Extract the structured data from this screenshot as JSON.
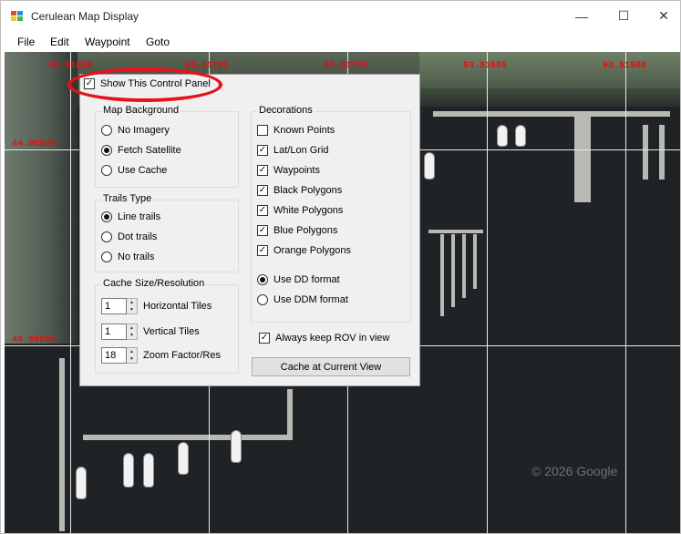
{
  "window": {
    "title": "Cerulean Map Display",
    "minimize_icon": "minimize-icon",
    "maximize_icon": "maximize-icon",
    "close_icon": "close-icon",
    "min_glyph": "—",
    "max_glyph": "☐",
    "close_glyph": "✕"
  },
  "menu": {
    "items": [
      {
        "label": "File"
      },
      {
        "label": "Edit"
      },
      {
        "label": "Waypoint"
      },
      {
        "label": "Goto"
      }
    ]
  },
  "map": {
    "grid_labels_top": [
      "93.51858",
      "93.51791",
      "93.51723",
      "93.51655",
      "93.51588"
    ],
    "grid_labels_left": [
      "44.96948",
      "44.96934"
    ],
    "watermark": "© 2026 Google",
    "colors": {
      "grid": "#e8e8e8",
      "label": "#e01010",
      "water": "#1f2326"
    }
  },
  "panel": {
    "show_panel": {
      "label": "Show This Control Panel",
      "checked": true
    },
    "map_background": {
      "title": "Map Background",
      "options": [
        {
          "label": "No Imagery",
          "selected": false
        },
        {
          "label": "Fetch Satellite",
          "selected": true
        },
        {
          "label": "Use Cache",
          "selected": false
        }
      ]
    },
    "trails_type": {
      "title": "Trails Type",
      "options": [
        {
          "label": "Line trails",
          "selected": true
        },
        {
          "label": "Dot trails",
          "selected": false
        },
        {
          "label": "No trails",
          "selected": false
        }
      ]
    },
    "cache": {
      "title": "Cache Size/Resolution",
      "horizontal": {
        "value": "1",
        "label": "Horizontal Tiles"
      },
      "vertical": {
        "value": "1",
        "label": "Vertical Tiles"
      },
      "zoom": {
        "value": "18",
        "label": "Zoom Factor/Res"
      }
    },
    "decorations": {
      "title": "Decorations",
      "checks": [
        {
          "label": "Known Points",
          "checked": false
        },
        {
          "label": "Lat/Lon Grid",
          "checked": true
        },
        {
          "label": "Waypoints",
          "checked": true
        },
        {
          "label": "Black Polygons",
          "checked": true
        },
        {
          "label": "White Polygons",
          "checked": true
        },
        {
          "label": "Blue Polygons",
          "checked": true
        },
        {
          "label": "Orange Polygons",
          "checked": true
        }
      ],
      "formats": [
        {
          "label": "Use DD format",
          "selected": true
        },
        {
          "label": "Use DDM format",
          "selected": false
        }
      ]
    },
    "keep_rov": {
      "label": "Always keep ROV in view",
      "checked": true
    },
    "cache_button": "Cache at Current View"
  },
  "annotation": {
    "highlight_color": "#e8101a"
  }
}
